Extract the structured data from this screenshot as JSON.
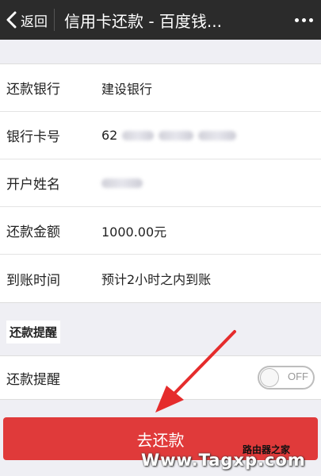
{
  "header": {
    "back_label": "返回",
    "title": "信用卡还款 - 百度钱..."
  },
  "details": [
    {
      "label": "还款银行",
      "value": "建设银行"
    },
    {
      "label": "银行卡号",
      "value": "62"
    },
    {
      "label": "开户姓名",
      "value": ""
    },
    {
      "label": "还款金额",
      "value": "1000.00元"
    },
    {
      "label": "到账时间",
      "value": "预计2小时之内到账"
    }
  ],
  "reminder": {
    "section_title": "还款提醒",
    "row_label": "还款提醒",
    "toggle_state": "OFF"
  },
  "pay_button_label": "去还款",
  "watermark": {
    "text": "Www.Tagxp.com",
    "corner_text": "路由器之家"
  },
  "colors": {
    "header_bg": "#2b2b2b",
    "accent_red": "#e03a3a",
    "page_bg": "#efeff4"
  }
}
